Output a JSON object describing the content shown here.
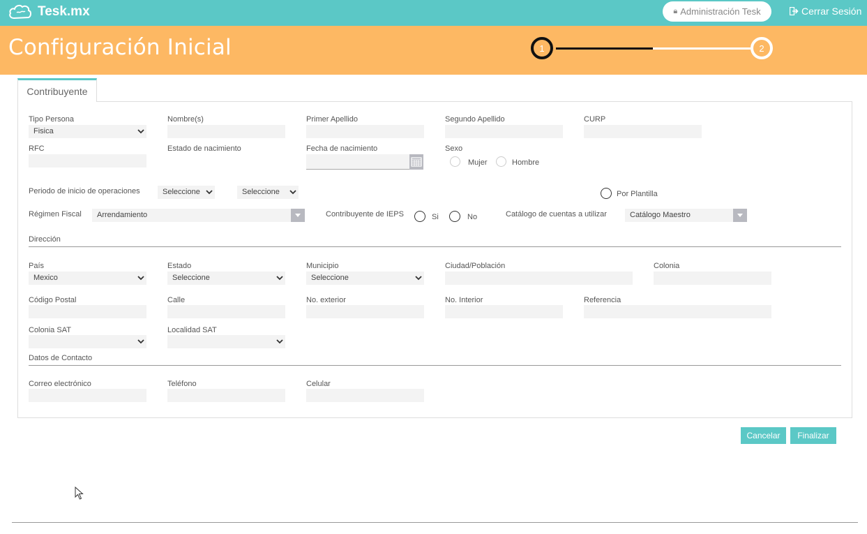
{
  "app": {
    "brand": "Tesk.mx",
    "admin_link": "Administración Tesk",
    "logout": "Cerrar Sesión",
    "colors": {
      "topbar": "#5bc8c6",
      "header": "#fdb863",
      "button": "#5bc8c6"
    }
  },
  "header": {
    "title": "Configuración Inicial",
    "steps": [
      "1",
      "2"
    ],
    "current_step": 1
  },
  "tab": {
    "label": "Contribuyente"
  },
  "form": {
    "tipo_persona": {
      "label": "Tipo Persona",
      "value": "Fisica"
    },
    "nombre": {
      "label": "Nombre(s)",
      "value": ""
    },
    "primer_apellido": {
      "label": "Primer Apellido",
      "value": ""
    },
    "segundo_apellido": {
      "label": "Segundo Apellido",
      "value": ""
    },
    "curp": {
      "label": "CURP",
      "value": ""
    },
    "rfc": {
      "label": "RFC",
      "value": ""
    },
    "estado_nacimiento": {
      "label": "Estado de nacimiento"
    },
    "fecha_nacimiento": {
      "label": "Fecha de nacimiento",
      "value": ""
    },
    "sexo": {
      "label": "Sexo",
      "options": [
        "Mujer",
        "Hombre"
      ]
    },
    "periodo": {
      "label": "Periodo de inicio de operaciones",
      "value1": "Seleccione",
      "value2": "Seleccione"
    },
    "por_plantilla": {
      "label": "Por Plantilla"
    },
    "regimen": {
      "label": "Régimen Fiscal",
      "value": "Arrendamiento"
    },
    "ieps": {
      "label": "Contribuyente de IEPS",
      "options": [
        "Si",
        "No"
      ]
    },
    "catalogo": {
      "label": "Catálogo de cuentas a utilizar",
      "value": "Catálogo Maestro"
    }
  },
  "direccion": {
    "title": "Dirección",
    "pais": {
      "label": "País",
      "value": "Mexico"
    },
    "estado": {
      "label": "Estado",
      "value": "Seleccione"
    },
    "municipio": {
      "label": "Municipio",
      "value": "Seleccione"
    },
    "ciudad": {
      "label": "Ciudad/Población",
      "value": ""
    },
    "colonia": {
      "label": "Colonia",
      "value": ""
    },
    "codigo_postal": {
      "label": "Código Postal",
      "value": ""
    },
    "calle": {
      "label": "Calle",
      "value": ""
    },
    "no_exterior": {
      "label": "No. exterior",
      "value": ""
    },
    "no_interior": {
      "label": "No. Interior",
      "value": ""
    },
    "referencia": {
      "label": "Referencia",
      "value": ""
    },
    "colonia_sat": {
      "label": "Colonia SAT",
      "value": ""
    },
    "localidad_sat": {
      "label": "Localidad SAT",
      "value": ""
    }
  },
  "contacto": {
    "title": "Datos de Contacto",
    "correo": {
      "label": "Correo electrónico",
      "value": ""
    },
    "telefono": {
      "label": "Teléfono",
      "value": ""
    },
    "celular": {
      "label": "Celular",
      "value": ""
    }
  },
  "actions": {
    "cancel": "Cancelar",
    "finish": "Finalizar"
  }
}
